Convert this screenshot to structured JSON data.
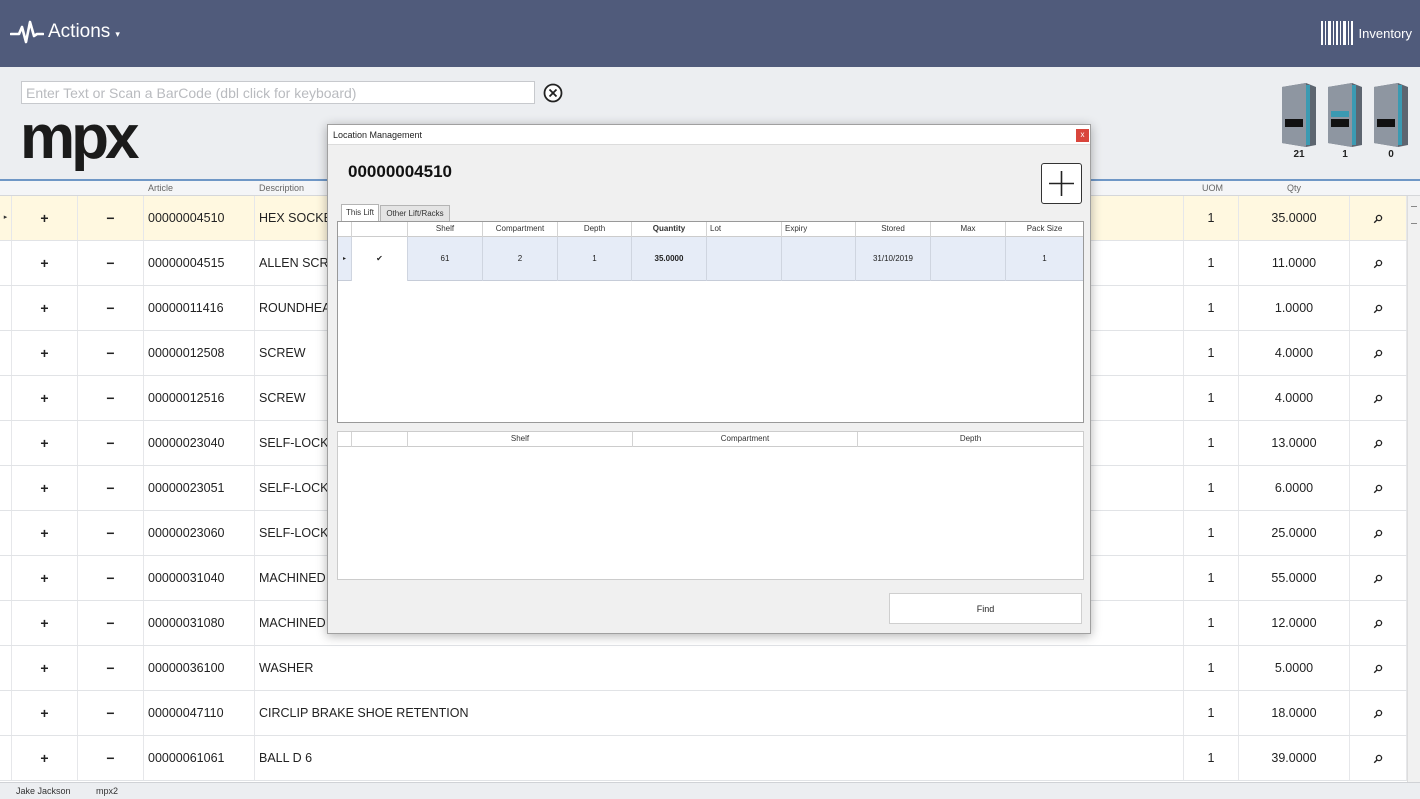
{
  "topbar": {
    "actions_label": "Actions",
    "actions_caret": "▾",
    "inventory_label": "Inventory"
  },
  "header": {
    "search_placeholder": "Enter Text or Scan a BarCode (dbl click for keyboard)",
    "logo": "mpx",
    "lifts": [
      {
        "count": "21"
      },
      {
        "count": "1"
      },
      {
        "count": "0"
      }
    ]
  },
  "grid": {
    "columns": {
      "article": "Article",
      "description": "Description",
      "uom": "UOM",
      "qty": "Qty"
    },
    "plus_symbol": "+",
    "minus_symbol": "−",
    "rows": [
      {
        "article": "00000004510",
        "description": "HEX SOCKET",
        "uom": "1",
        "qty": "35.0000"
      },
      {
        "article": "00000004515",
        "description": "ALLEN SCRE",
        "uom": "1",
        "qty": "11.0000"
      },
      {
        "article": "00000011416",
        "description": "ROUNDHEAD",
        "uom": "1",
        "qty": "1.0000"
      },
      {
        "article": "00000012508",
        "description": "SCREW",
        "uom": "1",
        "qty": "4.0000"
      },
      {
        "article": "00000012516",
        "description": "SCREW",
        "uom": "1",
        "qty": "4.0000"
      },
      {
        "article": "00000023040",
        "description": "SELF-LOCKIN",
        "uom": "1",
        "qty": "13.0000"
      },
      {
        "article": "00000023051",
        "description": "SELF-LOCKIN",
        "uom": "1",
        "qty": "6.0000"
      },
      {
        "article": "00000023060",
        "description": "SELF-LOCKIN",
        "uom": "1",
        "qty": "25.0000"
      },
      {
        "article": "00000031040",
        "description": "MACHINED F",
        "uom": "1",
        "qty": "55.0000"
      },
      {
        "article": "00000031080",
        "description": "MACHINED F",
        "uom": "1",
        "qty": "12.0000"
      },
      {
        "article": "00000036100",
        "description": "WASHER",
        "uom": "1",
        "qty": "5.0000"
      },
      {
        "article": "00000047110",
        "description": "CIRCLIP  BRAKE SHOE RETENTION",
        "uom": "1",
        "qty": "18.0000"
      },
      {
        "article": "00000061061",
        "description": "BALL  D 6",
        "uom": "1",
        "qty": "39.0000"
      }
    ]
  },
  "status": {
    "user": "Jake Jackson",
    "instance": "mpx2"
  },
  "dialog": {
    "title": "Location Management",
    "close": "x",
    "article_number": "00000004510",
    "tabs": {
      "this_lift": "This Lift",
      "other": "Other Lift/Racks"
    },
    "upper_columns": {
      "shelf": "Shelf",
      "compartment": "Compartment",
      "depth": "Depth",
      "quantity": "Quantity",
      "lot": "Lot",
      "expiry": "Expiry",
      "stored": "Stored",
      "max": "Max",
      "pack_size": "Pack Size"
    },
    "upper_row": {
      "check": "✔",
      "shelf": "61",
      "compartment": "2",
      "depth": "1",
      "quantity": "35.0000",
      "lot": "",
      "expiry": "",
      "stored": "31/10/2019",
      "max": "",
      "pack_size": "1"
    },
    "lower_columns": {
      "shelf": "Shelf",
      "compartment": "Compartment",
      "depth": "Depth"
    },
    "find_label": "Find"
  }
}
